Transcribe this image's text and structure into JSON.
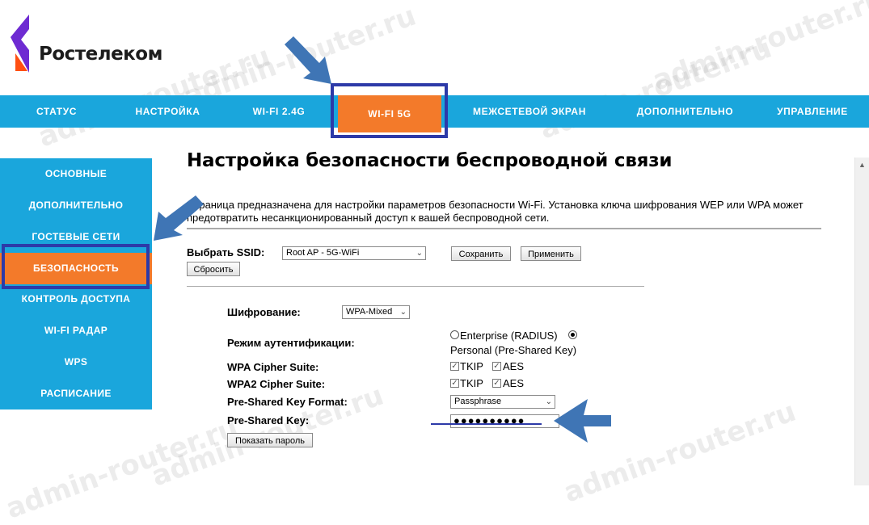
{
  "brand": {
    "name": "Ростелеком"
  },
  "watermark": "admin-router.ru",
  "colors": {
    "nav_bg": "#1aa6dc",
    "active_bg": "#f37a2a",
    "highlight": "#2d3aa8",
    "arrow": "#3f75b5",
    "logo": "#6e2bd2"
  },
  "topnav": [
    {
      "label": "СТАТУС"
    },
    {
      "label": "НАСТРОЙКА"
    },
    {
      "label": "WI-FI 2.4G"
    },
    {
      "label": "WI-FI 5G",
      "active": true
    },
    {
      "label": "МЕЖСЕТЕВОЙ ЭКРАН"
    },
    {
      "label": "ДОПОЛНИТЕЛЬНО"
    },
    {
      "label": "УПРАВЛЕНИЕ"
    }
  ],
  "sidebar": [
    {
      "label": "ОСНОВНЫЕ"
    },
    {
      "label": "ДОПОЛНИТЕЛЬНО"
    },
    {
      "label": "ГОСТЕВЫЕ СЕТИ"
    },
    {
      "label": "БЕЗОПАСНОСТЬ",
      "active": true
    },
    {
      "label": "КОНТРОЛЬ ДОСТУПА"
    },
    {
      "label": "WI-FI РАДАР"
    },
    {
      "label": "WPS"
    },
    {
      "label": "РАСПИСАНИЕ"
    }
  ],
  "page": {
    "title": "Настройка безопасности беспроводной связи",
    "description": "Страница предназначена для настройки параметров безопасности Wi-Fi. Установка ключа шифрования WEP или WPA может предотвратить несанкционированный доступ к вашей беспроводной сети."
  },
  "ssid": {
    "label": "Выбрать SSID:",
    "value": "Root AP - 5G-WiFi",
    "save": "Сохранить",
    "apply": "Применить",
    "reset": "Сбросить"
  },
  "form": {
    "encryption": {
      "label": "Шифрование:",
      "value": "WPA-Mixed"
    },
    "auth_mode": {
      "label": "Режим аутентификации:",
      "option1": "Enterprise (RADIUS)",
      "option2": "Personal (Pre-Shared Key)",
      "selected": "Personal (Pre-Shared Key)"
    },
    "wpa_cipher": {
      "label": "WPA Cipher Suite:",
      "opt1": "TKIP",
      "opt2": "AES"
    },
    "wpa2_cipher": {
      "label": "WPA2 Cipher Suite:",
      "opt1": "TKIP",
      "opt2": "AES"
    },
    "psk_format": {
      "label": "Pre-Shared Key Format:",
      "value": "Passphrase"
    },
    "psk": {
      "label": "Pre-Shared Key:",
      "value": "●●●●●●●●●●"
    },
    "show_password": "Показать пароль"
  }
}
